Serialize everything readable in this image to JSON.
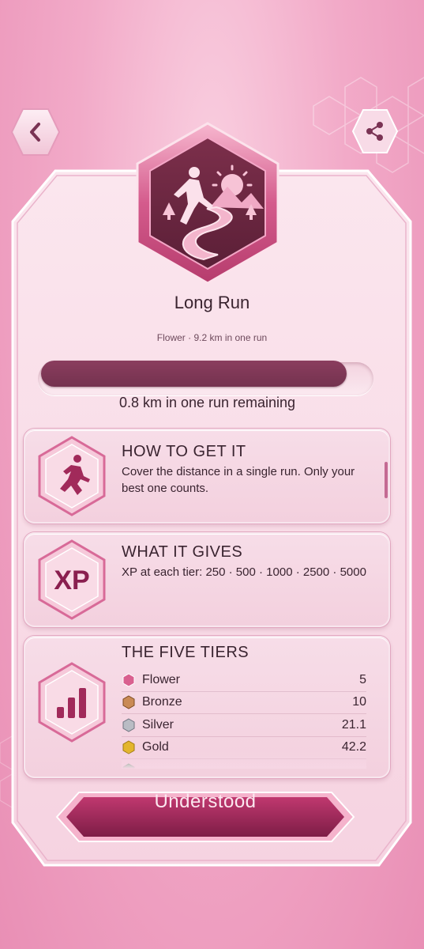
{
  "header": {
    "back_icon": "chevron-left-icon",
    "share_icon": "share-icon"
  },
  "badge": {
    "icon": "long-run-badge-icon",
    "title": "Long Run",
    "subtitle": "Flower · 9.2 km in one run"
  },
  "progress": {
    "fraction": 0.92,
    "remaining_text": "0.8 km in one run remaining"
  },
  "how_to": {
    "title": "HOW TO GET IT",
    "text": "Cover the distance in a single run. Only your best one counts.",
    "icon": "runner-icon"
  },
  "gives": {
    "title": "WHAT IT GIVES",
    "text": "XP at each tier: 250 · 500 · 1000 · 2500 · 5000",
    "icon_label": "XP"
  },
  "tiers": {
    "title": "THE FIVE TIERS",
    "icon": "bar-chart-icon",
    "rows": [
      {
        "name": "Flower",
        "value": "5",
        "color": "#d9608f"
      },
      {
        "name": "Bronze",
        "value": "10",
        "color": "#c98a55"
      },
      {
        "name": "Silver",
        "value": "21.1",
        "color": "#b9bcc4"
      },
      {
        "name": "Gold",
        "value": "42.2",
        "color": "#e3b52c"
      },
      {
        "name": "",
        "value": "",
        "color": "#2fae6a"
      }
    ]
  },
  "footer": {
    "button_label": "Understood"
  },
  "colors": {
    "accent": "#7a3354",
    "background": "#f2aac8"
  }
}
